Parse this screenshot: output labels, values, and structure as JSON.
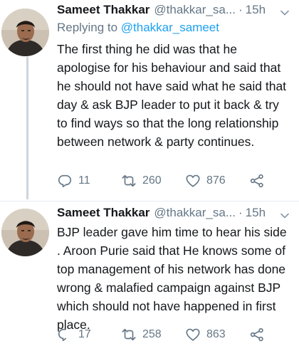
{
  "tweets": [
    {
      "author_name": "Sameet Thakkar",
      "author_handle": "@thakkar_sa...",
      "separator": "·",
      "time": "15h",
      "replying_prefix": "Replying to ",
      "replying_handle": "@thakkar_sameet",
      "text": "The first thing he did was that he apologise for his behaviour and said that he should not have said what he said that day & ask BJP leader to put it back & try to find ways so that the long relationship between network & party continues.",
      "replies": "11",
      "retweets": "260",
      "likes": "876"
    },
    {
      "author_name": "Sameet Thakkar",
      "author_handle": "@thakkar_sa...",
      "separator": "·",
      "time": "15h",
      "text": "BJP leader gave him time to hear his side . Aroon Purie said that He knows some of top management of his network has done wrong & malafied campaign against BJP which should not have happened in first place.",
      "replies": "17",
      "retweets": "258",
      "likes": "863"
    }
  ],
  "icons": {
    "reply": "reply-icon",
    "retweet": "retweet-icon",
    "like": "heart-icon",
    "share": "share-icon",
    "caret": "chevron-down-icon"
  },
  "colors": {
    "text": "#14171a",
    "secondary": "#657786",
    "link": "#1da1f2",
    "thread_line": "#ccd6dd"
  }
}
